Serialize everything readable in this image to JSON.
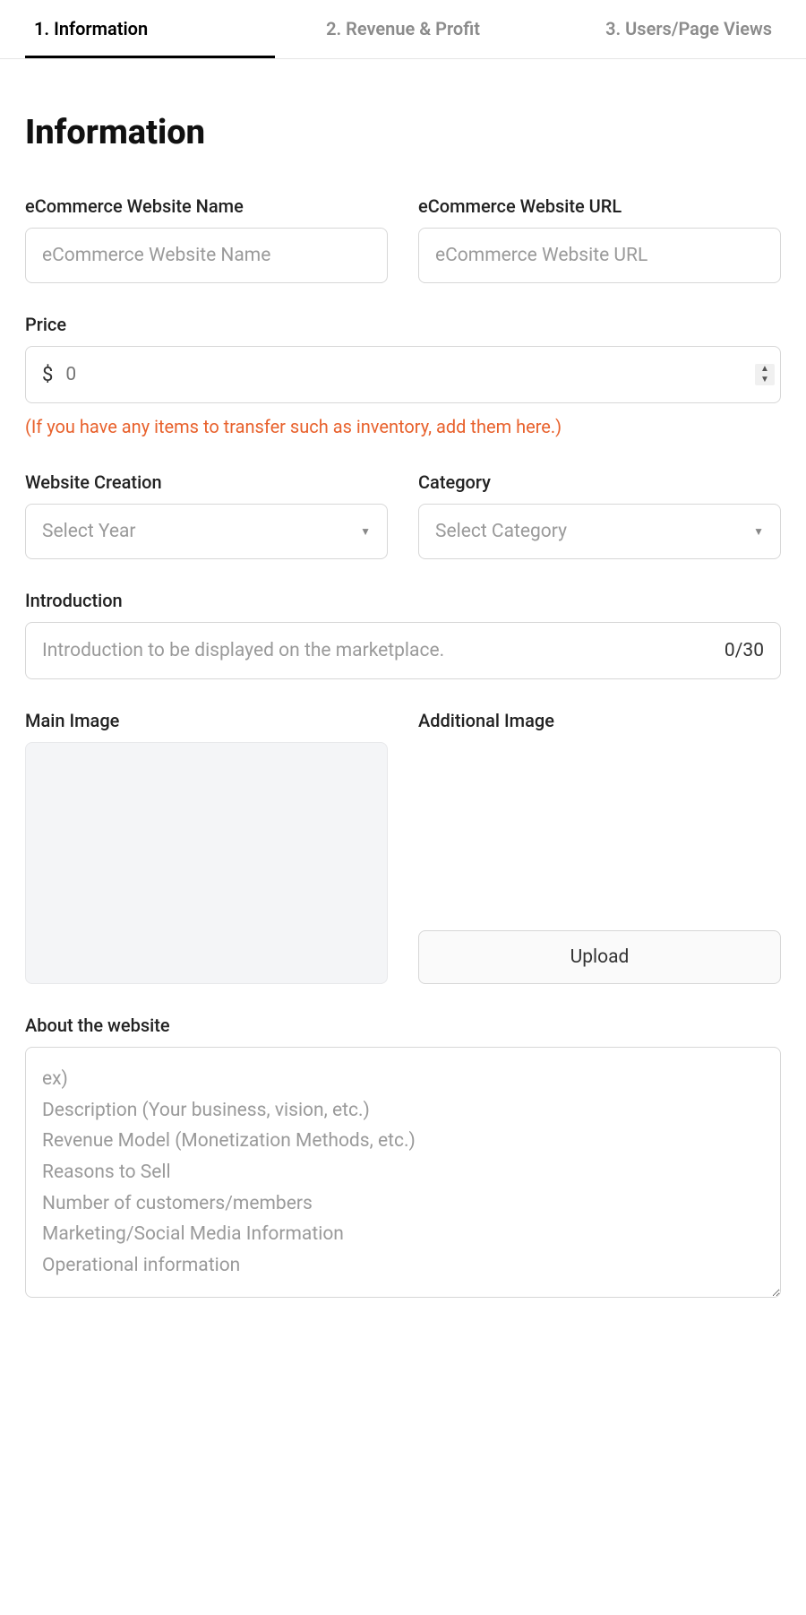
{
  "tabs": [
    {
      "label": "1. Information",
      "active": true
    },
    {
      "label": "2. Revenue & Profit",
      "active": false
    },
    {
      "label": "3. Users/Page Views",
      "active": false
    }
  ],
  "heading": "Information",
  "fields": {
    "name_label": "eCommerce Website Name",
    "name_placeholder": "eCommerce Website Name",
    "url_label": "eCommerce Website URL",
    "url_placeholder": "eCommerce Website URL",
    "price_label": "Price",
    "price_currency": "$",
    "price_placeholder": "0",
    "price_hint": "(If you have any items to transfer such as inventory, add them here.)",
    "creation_label": "Website Creation",
    "creation_placeholder": "Select Year",
    "category_label": "Category",
    "category_placeholder": "Select Category",
    "intro_label": "Introduction",
    "intro_placeholder": "Introduction to be displayed on the marketplace.",
    "intro_counter": "0/30",
    "main_image_label": "Main Image",
    "additional_image_label": "Additional Image",
    "upload_button": "Upload",
    "about_label": "About the website",
    "about_placeholder": "ex)\nDescription (Your business, vision, etc.)\nRevenue Model (Monetization Methods, etc.)\nReasons to Sell\nNumber of customers/members\nMarketing/Social Media Information\nOperational information"
  }
}
